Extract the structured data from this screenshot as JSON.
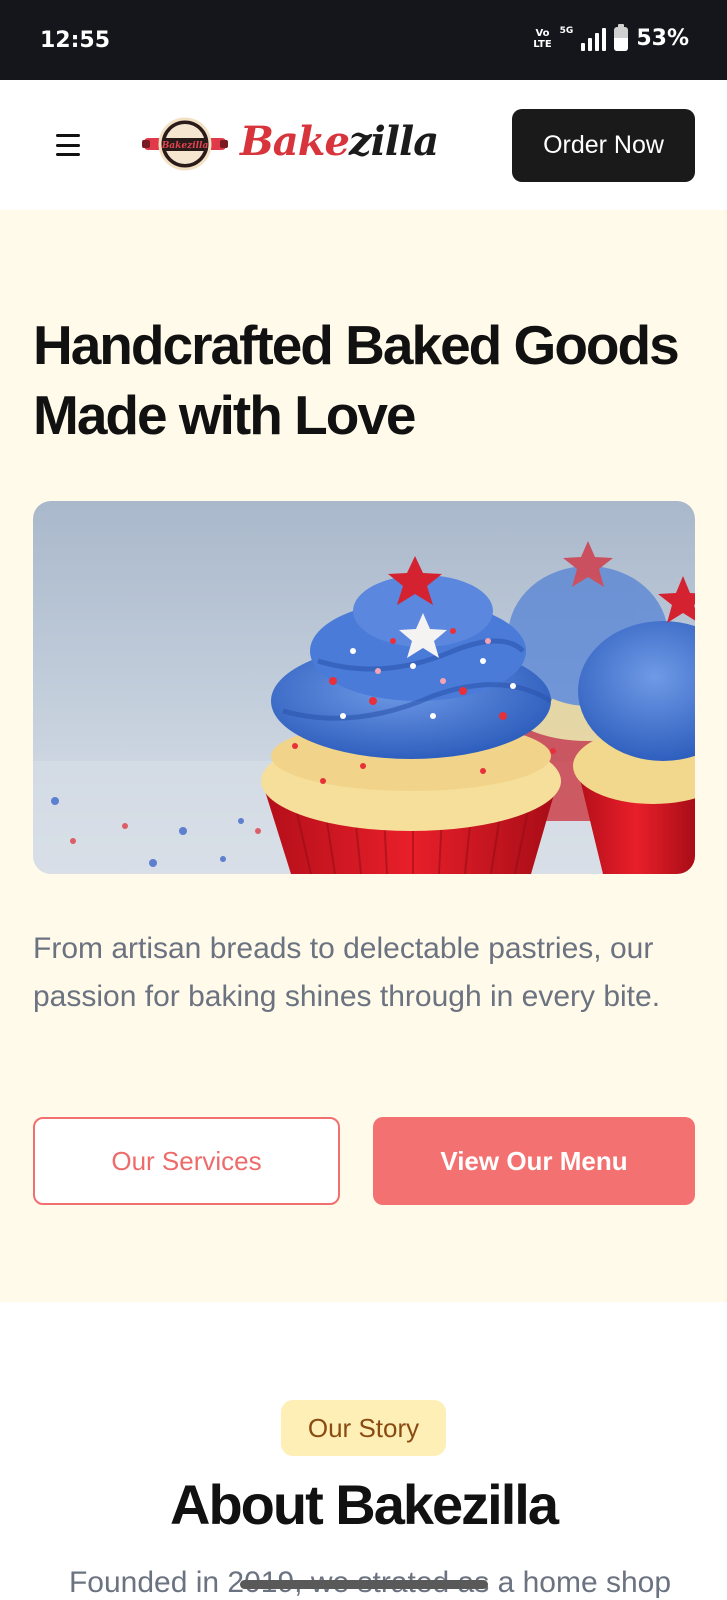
{
  "status_bar": {
    "time": "12:55",
    "volte_top": "Vo",
    "volte_bottom": "LTE",
    "network": "5G",
    "battery_percent": "53%",
    "battery_level": 0.53
  },
  "header": {
    "brand_part1": "Bake",
    "brand_part2": "zilla",
    "logo_badge_text": "Bakezilla",
    "order_button": "Order Now"
  },
  "hero": {
    "title_line1": "Handcrafted Baked Goods",
    "title_line2": "Made with Love",
    "description": "From artisan breads to delectable pastries, our passion for baking shines through in every bite.",
    "services_button": "Our Services",
    "menu_button": "View Our Menu"
  },
  "about": {
    "badge": "Our Story",
    "title": "About Bakezilla",
    "text": "Founded in 2019, we strated as a home shop"
  },
  "colors": {
    "status_bar_bg": "#15161b",
    "hero_bg": "#fffaea",
    "accent_red": "#f47171",
    "brand_red": "#d8343c",
    "badge_bg": "#fdefb6"
  }
}
